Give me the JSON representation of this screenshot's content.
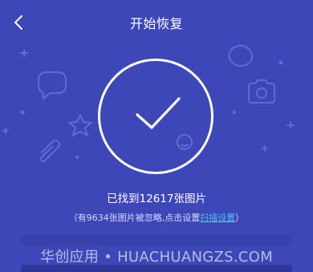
{
  "header": {
    "title": "开始恢复",
    "back_icon": "chevron-left-icon"
  },
  "result": {
    "found_text": "已找到12617张图片",
    "note_prefix": "（有9634张图片被忽略,点击设置",
    "note_link": "扫描设置",
    "note_suffix": "）"
  },
  "watermark": {
    "text": "华创应用 • HUACHUANGZS.COM"
  },
  "colors": {
    "background": "#3d47b8",
    "link": "#47c7e0",
    "primary_text": "#ffffff"
  }
}
